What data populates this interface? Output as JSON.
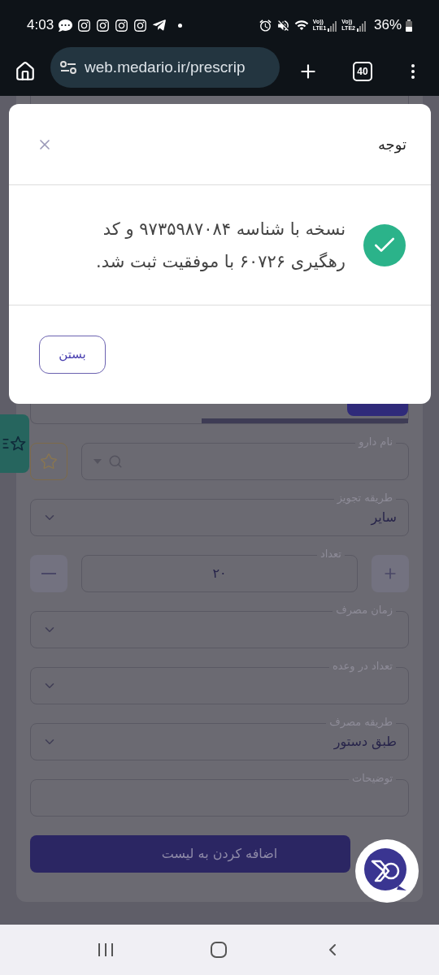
{
  "status_bar": {
    "time": "4:03",
    "sim_1": {
      "top": "Vo))",
      "bottom": "LTE1"
    },
    "sim_2": {
      "top": "Vo))",
      "bottom": "LTE2"
    },
    "battery": "36%"
  },
  "browser": {
    "url": "web.medario.ir/prescrip",
    "tab_count": "40"
  },
  "dialog": {
    "title": "توجه",
    "message": "نسخه با شناسه ۹۷۳۵۹۸۷۰۸۴ و کد رهگیری ۶۰۷۲۶ با موفقیت ثبت شد.",
    "button": "بستن"
  },
  "form": {
    "fields": [
      {
        "kind": "search",
        "label": "نام دارو"
      },
      {
        "kind": "select",
        "label": "طریقه تجویز",
        "value": "سایر"
      },
      {
        "kind": "stepper",
        "label": "تعداد",
        "value": "۲۰"
      },
      {
        "kind": "select",
        "label": "زمان مصرف"
      },
      {
        "kind": "select",
        "label": "تعداد در وعده"
      },
      {
        "kind": "select",
        "label": "طریقه مصرف",
        "value": "طبق دستور"
      },
      {
        "kind": "textarea",
        "label": "توضیحات"
      }
    ],
    "add_button": "اضافه کردن به لیست"
  }
}
